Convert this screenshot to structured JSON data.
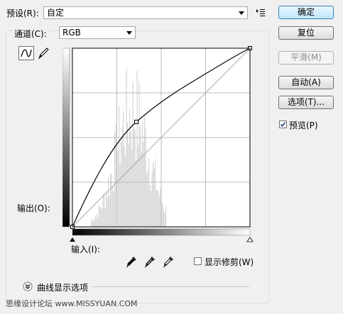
{
  "preset": {
    "label": "预设(R):",
    "value": "自定"
  },
  "channel": {
    "label": "通道(C):",
    "value": "RGB"
  },
  "buttons": {
    "ok": "确定",
    "reset": "复位",
    "smooth": "平滑(M)",
    "auto": "自动(A)",
    "options": "选项(T)..."
  },
  "preview": {
    "label": "预览(P)",
    "checked": true
  },
  "output_label": "输出(O):",
  "input_label": "输入(I):",
  "show_clipping": {
    "label": "显示修剪(W)",
    "checked": false
  },
  "curve_display_options": "曲线显示选项",
  "watermark": "思缘设计论坛 www.MISSYUAN.COM",
  "icons": {
    "preset_menu": "preset-options-icon",
    "curve_tool": "curve-point-tool-icon",
    "pencil_tool": "pencil-tool-icon",
    "black_eyedropper": "black-point-eyedropper-icon",
    "gray_eyedropper": "gray-point-eyedropper-icon",
    "white_eyedropper": "white-point-eyedropper-icon",
    "expand": "expand-chevron-icon"
  }
}
